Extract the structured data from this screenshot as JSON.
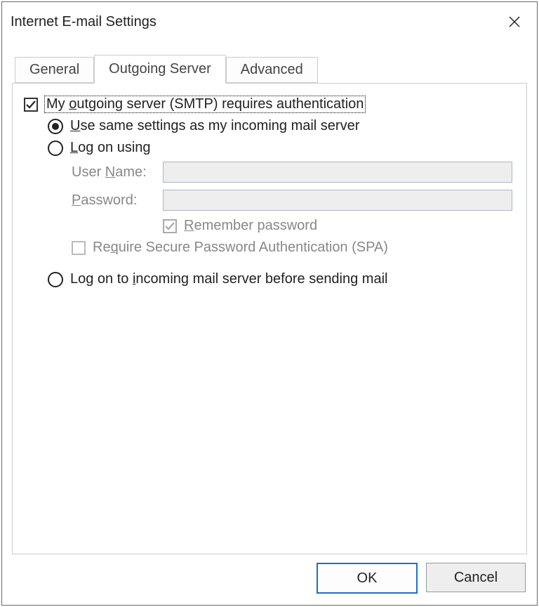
{
  "dialog": {
    "title": "Internet E-mail Settings",
    "tabs": {
      "general": "General",
      "outgoing": "Outgoing Server",
      "advanced": "Advanced",
      "active": "outgoing"
    },
    "outgoing": {
      "main_checkbox": {
        "checked": true,
        "label_pre": "My ",
        "label_u": "o",
        "label_post": "utgoing server (SMTP) requires authentication"
      },
      "radio_same": {
        "selected": true,
        "label_u": "U",
        "label_post": "se same settings as my incoming mail server"
      },
      "radio_logon": {
        "selected": false,
        "label_u": "L",
        "label_post": "og on using"
      },
      "username": {
        "label_pre": "User ",
        "label_u": "N",
        "label_post": "ame:",
        "value": ""
      },
      "password": {
        "label_u": "P",
        "label_post": "assword:",
        "value": ""
      },
      "remember": {
        "checked": true,
        "label_u": "R",
        "label_post": "emember password"
      },
      "spa": {
        "checked": false,
        "label_pre": "Re",
        "label_u": "q",
        "label_post": "uire Secure Password Authentication (SPA)"
      },
      "radio_incoming": {
        "selected": false,
        "label_pre": "Log on to ",
        "label_u": "i",
        "label_post": "ncoming mail server before sending mail"
      }
    },
    "buttons": {
      "ok": "OK",
      "cancel": "Cancel"
    }
  }
}
